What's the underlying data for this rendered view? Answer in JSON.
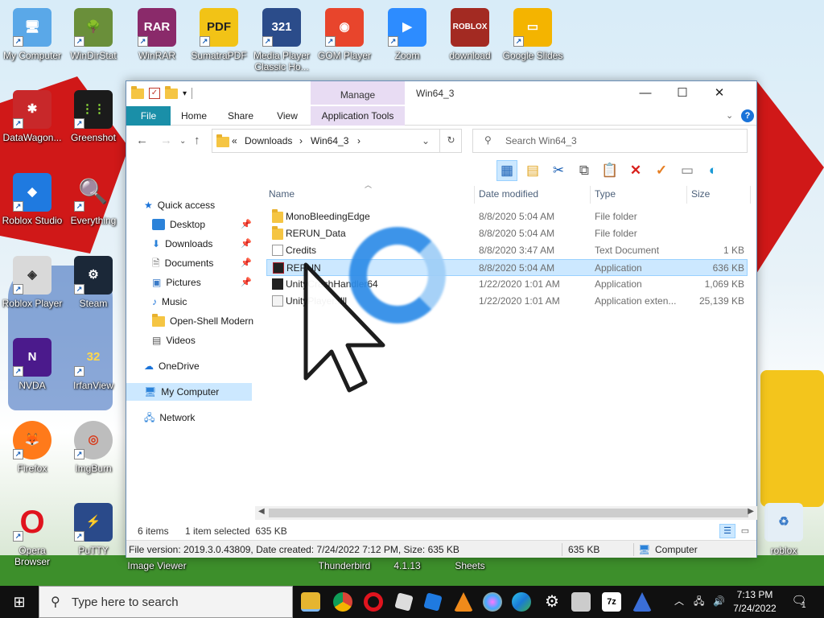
{
  "desktop": {
    "icons": [
      {
        "label": "My Computer"
      },
      {
        "label": "WinDirStat"
      },
      {
        "label": "WinRAR"
      },
      {
        "label": "SumatraPDF"
      },
      {
        "label": "Media Player Classic Ho..."
      },
      {
        "label": "GOM Player"
      },
      {
        "label": "Zoom"
      },
      {
        "label": "download"
      },
      {
        "label": "Google Slides"
      },
      {
        "label": "DataWagon..."
      },
      {
        "label": "Greenshot"
      },
      {
        "label": "Roblox Studio"
      },
      {
        "label": "Everything"
      },
      {
        "label": "Roblox Player"
      },
      {
        "label": "Steam"
      },
      {
        "label": "NVDA"
      },
      {
        "label": "IrfanView"
      },
      {
        "label": "Firefox"
      },
      {
        "label": "ImgBurn"
      },
      {
        "label": "Opera Browser"
      },
      {
        "label": "PuTTY"
      },
      {
        "label": "roblox"
      }
    ],
    "partial_labels": {
      "image_viewer": "Image Viewer",
      "thunderbird": "Thunderbird",
      "version": "4.1.13",
      "sheets": "Sheets"
    }
  },
  "window": {
    "title": "Win64_3",
    "manage_tab": "Manage",
    "ribbon_tabs": [
      "File",
      "Home",
      "Share",
      "View",
      "Application Tools"
    ],
    "address": {
      "overflow": "«",
      "segments": [
        "Downloads",
        "Win64_3"
      ]
    },
    "search_placeholder": "Search Win64_3",
    "nav": {
      "quick_access": "Quick access",
      "items": [
        "Desktop",
        "Downloads",
        "Documents",
        "Pictures",
        "Music",
        "Open-Shell Modern",
        "Videos"
      ],
      "onedrive": "OneDrive",
      "my_computer": "My Computer",
      "network": "Network"
    },
    "columns": {
      "name": "Name",
      "date": "Date modified",
      "type": "Type",
      "size": "Size"
    },
    "files": [
      {
        "name": "MonoBleedingEdge",
        "date": "8/8/2020 5:04 AM",
        "type": "File folder",
        "size": ""
      },
      {
        "name": "RERUN_Data",
        "date": "8/8/2020 5:04 AM",
        "type": "File folder",
        "size": ""
      },
      {
        "name": "Credits",
        "date": "8/8/2020 3:47 AM",
        "type": "Text Document",
        "size": "1 KB"
      },
      {
        "name": "RERUN",
        "date": "8/8/2020 5:04 AM",
        "type": "Application",
        "size": "636 KB"
      },
      {
        "name": "UnityCrashHandler64",
        "date": "1/22/2020 1:01 AM",
        "type": "Application",
        "size": "1,069 KB"
      },
      {
        "name": "UnityPlayer.dll",
        "date": "1/22/2020 1:01 AM",
        "type": "Application exten...",
        "size": "25,139 KB"
      }
    ],
    "status": {
      "count": "6 items",
      "selected": "1 item selected  635 KB"
    },
    "info": {
      "details": "File version: 2019.3.0.43809, Date created: 7/24/2022 7:12 PM, Size: 635 KB",
      "size": "635 KB",
      "location": "Computer"
    }
  },
  "taskbar": {
    "search_placeholder": "Type here to search",
    "time": "7:13 PM",
    "date": "7/24/2022",
    "notification_count": "1"
  }
}
